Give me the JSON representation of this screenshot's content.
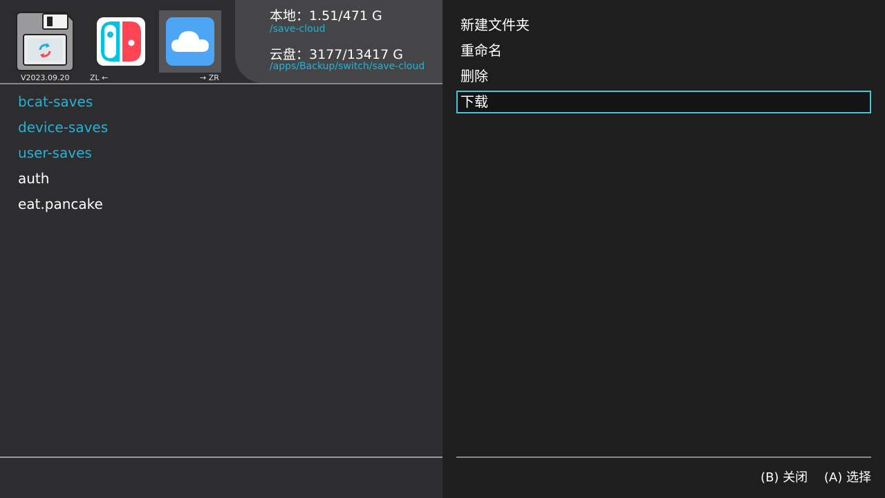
{
  "header": {
    "version": "V2023.09.20",
    "zl_label": "ZL ←",
    "zr_label": "→ ZR",
    "local_storage": "本地：1.51/471 G",
    "local_path": "/save-cloud",
    "cloud_storage": "云盘：3177/13417 G",
    "cloud_path": "/apps/Backup/switch/save-cloud",
    "icons": [
      "app-logo-icon",
      "switch-console-icon",
      "cloud-icon"
    ]
  },
  "files": [
    {
      "name": "bcat-saves",
      "type": "folder"
    },
    {
      "name": "device-saves",
      "type": "folder"
    },
    {
      "name": "user-saves",
      "type": "folder"
    },
    {
      "name": "auth",
      "type": "file"
    },
    {
      "name": "eat.pancake",
      "type": "file"
    }
  ],
  "menu": {
    "items": [
      {
        "label": "新建文件夹"
      },
      {
        "label": "重命名"
      },
      {
        "label": "删除"
      },
      {
        "label": "下载",
        "selected": true
      }
    ],
    "hints": {
      "close": "(B) 关闭",
      "select": "(A) 选择"
    }
  },
  "colors": {
    "accent": "#23b3d6",
    "selection_border": "#3fc9e0",
    "left_bg": "#2d2d30",
    "menu_bg": "#1e1e1f",
    "switch_red": "#ff4554",
    "switch_blue": "#00c3e3",
    "cloud_blue": "#4da6f5"
  }
}
